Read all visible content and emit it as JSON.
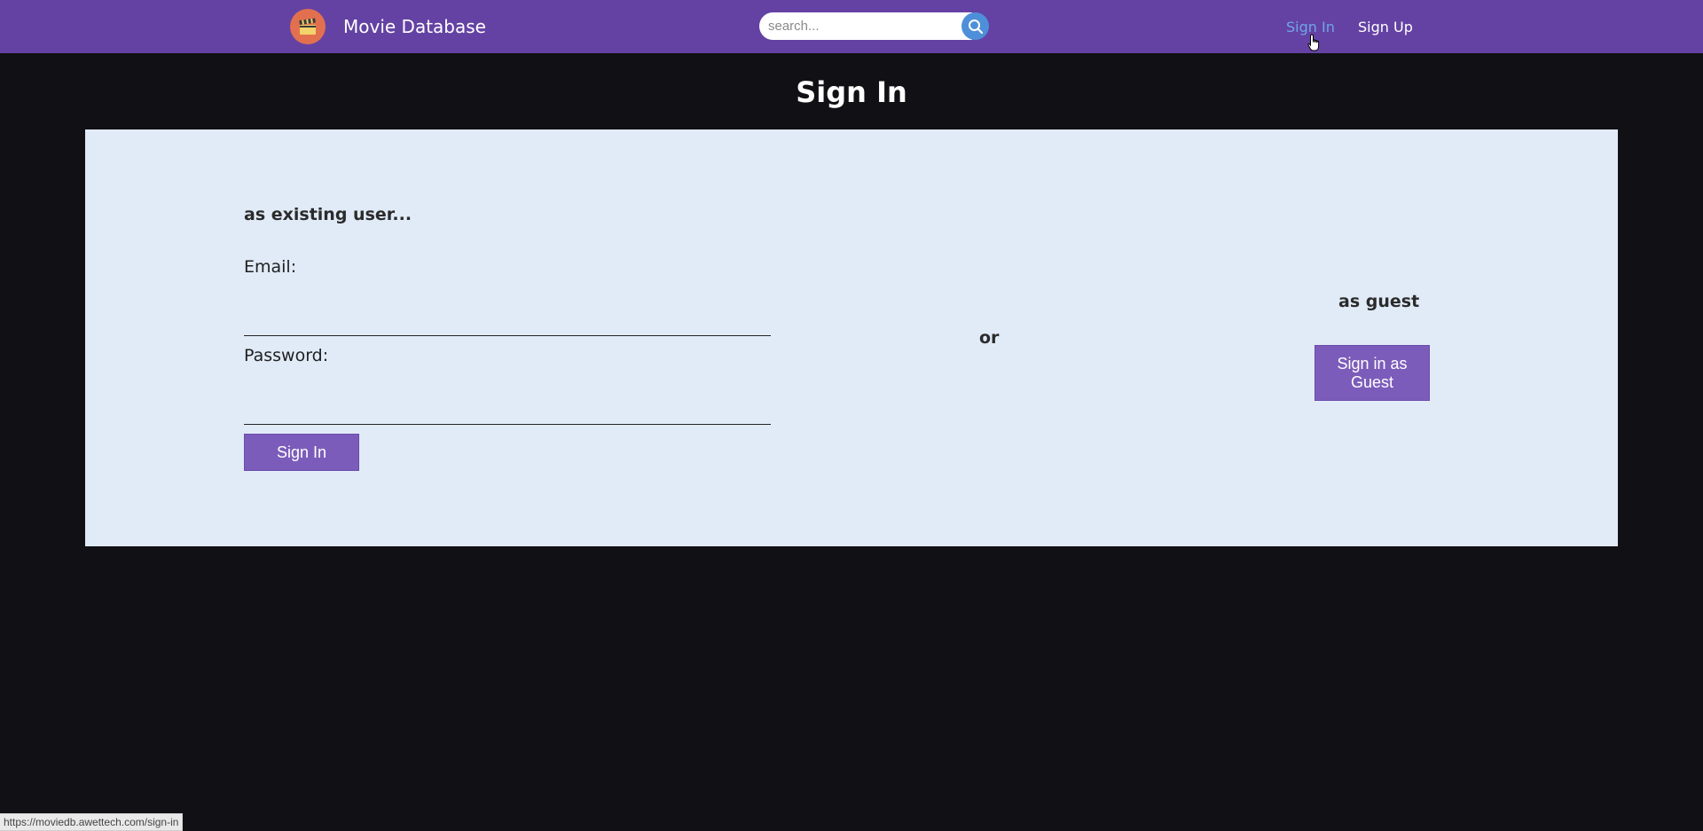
{
  "navbar": {
    "brand": "Movie Database",
    "logo_icon": "clapperboard-icon",
    "search_placeholder": "search...",
    "search_icon": "search-icon",
    "links": {
      "sign_in": "Sign In",
      "sign_up": "Sign Up"
    },
    "colors": {
      "background": "#6442a3",
      "active_link": "#6fa6e8"
    }
  },
  "page": {
    "title": "Sign In"
  },
  "existing_user": {
    "heading": "as existing user...",
    "email_label": "Email:",
    "email_value": "",
    "password_label": "Password:",
    "password_value": "",
    "submit_label": "Sign In"
  },
  "separator": {
    "text": "or"
  },
  "guest": {
    "heading": "as guest",
    "button_label": "Sign in as Guest"
  },
  "status_bar": {
    "url": "https://moviedb.awettech.com/sign-in"
  },
  "colors": {
    "page_background": "#111014",
    "card_background": "#e1ebf8",
    "button": "#7c5cba"
  }
}
